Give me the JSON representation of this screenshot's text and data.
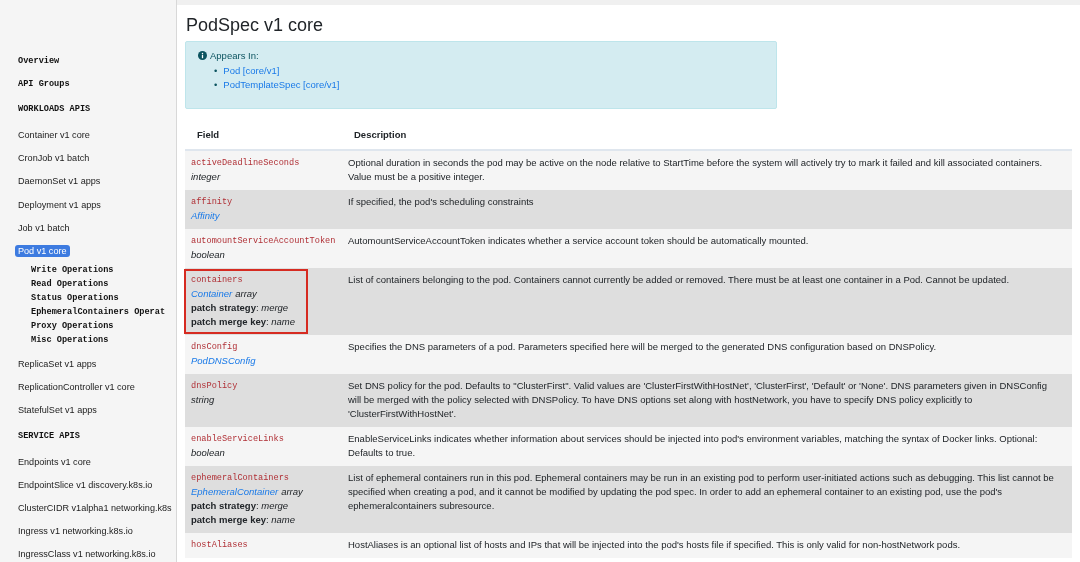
{
  "sidebar": {
    "items": [
      {
        "kind": "heading",
        "label": "Overview",
        "selected": false
      },
      {
        "kind": "heading",
        "label": "API Groups",
        "selected": false
      },
      {
        "kind": "section",
        "label": "WORKLOADS APIS",
        "selected": false
      },
      {
        "kind": "link",
        "label": "Container v1 core",
        "selected": false
      },
      {
        "kind": "link",
        "label": "CronJob v1 batch",
        "selected": false
      },
      {
        "kind": "link",
        "label": "DaemonSet v1 apps",
        "selected": false
      },
      {
        "kind": "link",
        "label": "Deployment v1 apps",
        "selected": false
      },
      {
        "kind": "link",
        "label": "Job v1 batch",
        "selected": false
      },
      {
        "kind": "link",
        "label": "Pod v1 core",
        "selected": true,
        "children": [
          {
            "label": "Write Operations"
          },
          {
            "label": "Read Operations"
          },
          {
            "label": "Status Operations"
          },
          {
            "label": "EphemeralContainers Operat"
          },
          {
            "label": "Proxy Operations"
          },
          {
            "label": "Misc Operations"
          }
        ]
      },
      {
        "kind": "link",
        "label": "ReplicaSet v1 apps",
        "selected": false
      },
      {
        "kind": "link",
        "label": "ReplicationController v1 core",
        "selected": false
      },
      {
        "kind": "link",
        "label": "StatefulSet v1 apps",
        "selected": false
      },
      {
        "kind": "section",
        "label": "SERVICE APIS",
        "selected": false
      },
      {
        "kind": "link",
        "label": "Endpoints v1 core",
        "selected": false
      },
      {
        "kind": "link",
        "label": "EndpointSlice v1 discovery.k8s.io",
        "selected": false
      },
      {
        "kind": "link",
        "label": "ClusterCIDR v1alpha1 networking.k8s",
        "selected": false
      },
      {
        "kind": "link",
        "label": "Ingress v1 networking.k8s.io",
        "selected": false
      },
      {
        "kind": "link",
        "label": "IngressClass v1 networking.k8s.io",
        "selected": false
      }
    ]
  },
  "title": "PodSpec v1 core",
  "appears_in": {
    "heading": "Appears In:",
    "links": [
      {
        "marker": "•",
        "label": "Pod [core/v1]"
      },
      {
        "marker": "•",
        "label": "PodTemplateSpec [core/v1]"
      }
    ]
  },
  "table": {
    "columns": [
      "Field",
      "Description"
    ],
    "rows": [
      {
        "field": "activeDeadlineSeconds",
        "type": {
          "text": "integer",
          "link": false
        },
        "highlighted": false,
        "description": "Optional duration in seconds the pod may be active on the node relative to StartTime before the system will actively try to mark it failed and kill associated containers. Value must be a positive integer."
      },
      {
        "field": "affinity",
        "type": {
          "text": "Affinity",
          "link": true
        },
        "highlighted": false,
        "description": "If specified, the pod's scheduling constraints"
      },
      {
        "field": "automountServiceAccountToken",
        "type": {
          "text": "boolean",
          "link": false
        },
        "highlighted": false,
        "description": "AutomountServiceAccountToken indicates whether a service account token should be automatically mounted."
      },
      {
        "field": "containers",
        "type": {
          "text": "Container",
          "link": true,
          "suffix": "array"
        },
        "details": [
          "**patch strategy**: *merge*",
          "**patch merge key**: *name*"
        ],
        "highlighted": true,
        "description": "List of containers belonging to the pod. Containers cannot currently be added or removed. There must be at least one container in a Pod. Cannot be updated."
      },
      {
        "field": "dnsConfig",
        "type": {
          "text": "PodDNSConfig",
          "link": true
        },
        "highlighted": false,
        "description": "Specifies the DNS parameters of a pod. Parameters specified here will be merged to the generated DNS configuration based on DNSPolicy."
      },
      {
        "field": "dnsPolicy",
        "type": {
          "text": "string",
          "link": false
        },
        "highlighted": false,
        "description": "Set DNS policy for the pod. Defaults to \"ClusterFirst\". Valid values are 'ClusterFirstWithHostNet', 'ClusterFirst', 'Default' or 'None'. DNS parameters given in DNSConfig will be merged with the policy selected with DNSPolicy. To have DNS options set along with hostNetwork, you have to specify DNS policy explicitly to 'ClusterFirstWithHostNet'."
      },
      {
        "field": "enableServiceLinks",
        "type": {
          "text": "boolean",
          "link": false
        },
        "highlighted": false,
        "description": "EnableServiceLinks indicates whether information about services should be injected into pod's environment variables, matching the syntax of Docker links. Optional: Defaults to true."
      },
      {
        "field": "ephemeralContainers",
        "type": {
          "text": "EphemeralContainer",
          "link": true,
          "suffix": "array"
        },
        "details": [
          "**patch strategy**: *merge*",
          "**patch merge key**: *name*"
        ],
        "highlighted": false,
        "description": "List of ephemeral containers run in this pod. Ephemeral containers may be run in an existing pod to perform user-initiated actions such as debugging. This list cannot be specified when creating a pod, and it cannot be modified by updating the pod spec. In order to add an ephemeral container to an existing pod, use the pod's ephemeralcontainers subresource."
      },
      {
        "field": "hostAliases",
        "highlighted": false,
        "description": "HostAliases is an optional list of hosts and IPs that will be injected into the pod's hosts file if specified. This is only valid for non-hostNetwork pods."
      }
    ]
  }
}
